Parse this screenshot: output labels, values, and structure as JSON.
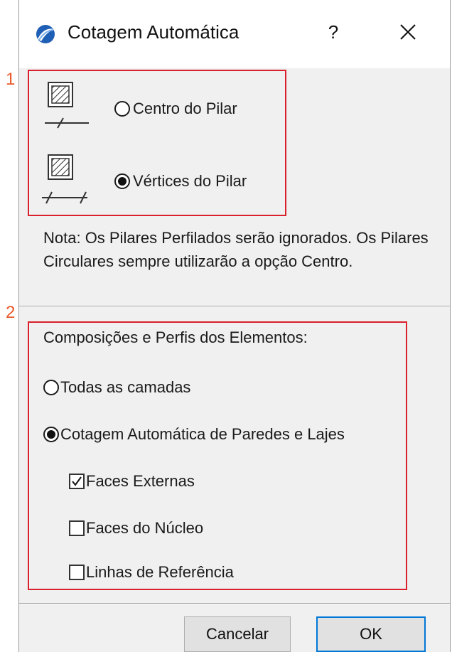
{
  "window": {
    "title": "Cotagem Automática",
    "help_label": "?",
    "icons": {
      "app": "archicad-app-icon",
      "close": "close-icon"
    }
  },
  "callouts": {
    "one": "1",
    "two": "2"
  },
  "column_options": {
    "center_label": "Centro do Pilar",
    "vertices_label": "Vértices do Pilar",
    "selected": "vertices"
  },
  "note": "Nota: Os Pilares Perfilados serão ignorados. Os Pilares Circulares sempre utilizarão a opção Centro.",
  "composites": {
    "heading": "Composições e Perfis dos Elementos:",
    "all_layers_label": "Todas as camadas",
    "auto_walls_label": "Cotagem Automática de Paredes e Lajes",
    "selected": "auto_walls",
    "options": [
      {
        "label": "Faces Externas",
        "checked": true
      },
      {
        "label": "Faces do Núcleo",
        "checked": false
      },
      {
        "label": "Linhas de Referência",
        "checked": false
      }
    ]
  },
  "buttons": {
    "cancel": "Cancelar",
    "ok": "OK"
  },
  "colors": {
    "callout": "#e8592a",
    "highlight_box": "#d9202c",
    "default_button": "#0078d7"
  }
}
